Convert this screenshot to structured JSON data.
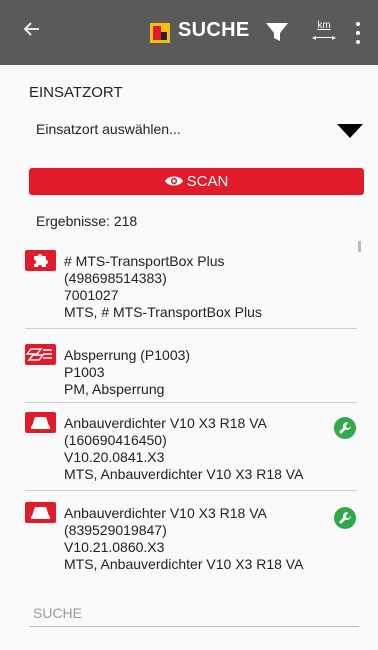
{
  "appbar": {
    "title": "SUCHE",
    "km_label": "km",
    "icons": [
      "back-arrow-icon",
      "app-logo-icon",
      "filter-icon",
      "distance-km-icon",
      "more-vert-icon"
    ]
  },
  "location": {
    "label": "EINSATZORT",
    "select_value": "Einsatzort auswählen..."
  },
  "scan": {
    "label": "SCAN"
  },
  "results": {
    "count_text": "Ergebnisse: 218",
    "items": [
      {
        "icon": "transportbox-puzzle-icon",
        "lines": [
          "# MTS-TransportBox Plus",
          "(498698514383)",
          "7001027",
          "MTS,  # MTS-TransportBox Plus"
        ],
        "service": false
      },
      {
        "icon": "barrier-icon",
        "lines": [
          "Absperrung (P1003)",
          "P1003",
          "PM,  Absperrung"
        ],
        "service": false
      },
      {
        "icon": "compactor-icon",
        "lines": [
          "Anbauverdichter V10 X3 R18 VA",
          "(160690416450)",
          "V10.20.0841.X3",
          "MTS,  Anbauverdichter V10 X3 R18 VA"
        ],
        "service": true
      },
      {
        "icon": "compactor-icon",
        "lines": [
          "Anbauverdichter V10 X3 R18 VA",
          "(839529019847)",
          "V10.21.0860.X3",
          "MTS,  Anbauverdichter V10 X3 R18 VA"
        ],
        "service": true
      }
    ]
  },
  "search": {
    "placeholder": "SUCHE",
    "value": ""
  },
  "colors": {
    "appbar": "#5a5a5a",
    "accent_red": "#e21b2a",
    "service_green": "#2faa4a"
  }
}
